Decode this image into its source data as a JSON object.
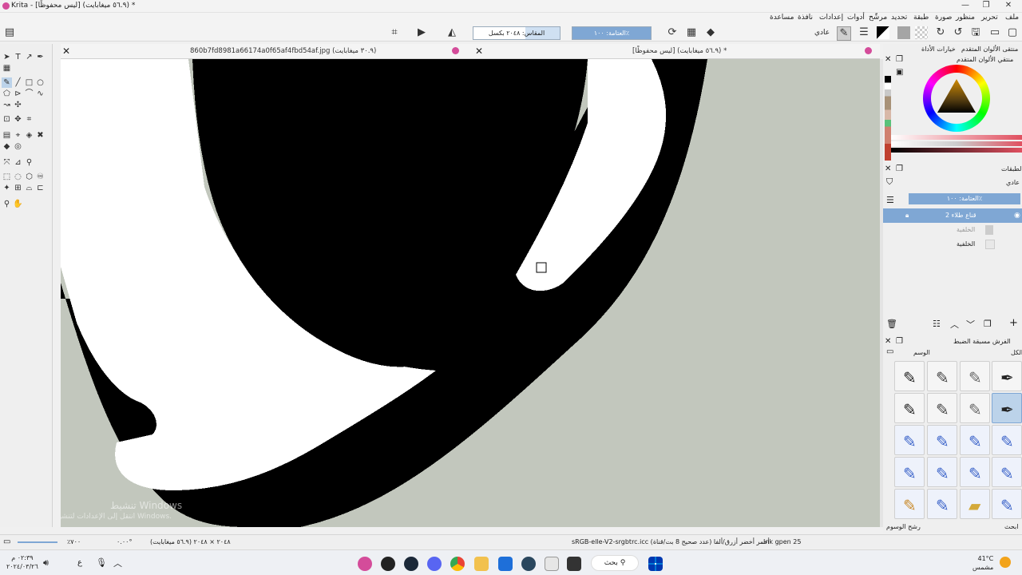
{
  "window": {
    "title": "Krita - [ليس محفوظًا]  (٥٦.٩ ميغابايت) *",
    "controls": [
      "—",
      "❐",
      "✕"
    ]
  },
  "menubar": {
    "items": [
      "ملف",
      "تحرير",
      "منظور",
      "صورة",
      "طبقة",
      "تحديد",
      "مرشّح",
      "أدوات",
      "إعدادات",
      "نافذة",
      "مساعدة"
    ]
  },
  "toolbar": {
    "blend_mode": "عادي",
    "opacity_label": "العتامة: ١٠٠٪",
    "size_label": "المقاس: ٢٠٤٨ بكسل"
  },
  "tabs": [
    {
      "label": "860b7fd8981a66174a0f65af4fbd54af.jpg  (٣٠.٩ ميغابايت)"
    },
    {
      "label": "[ليس محفوظًا]  (٥٦.٩ ميغابايت) *"
    }
  ],
  "right_dock": {
    "top_tabs": [
      "منتقى الألوان المتقدم",
      "خيارات الأداة"
    ],
    "color_panel_title": "منتقي الألوان المتقدم",
    "layers_title": "الطبقات",
    "layers_blend": "عادي",
    "layers_opacity": "العتامة: ١٠٠٪",
    "layers": [
      {
        "name": "قناع طلاء 2",
        "selected": true
      },
      {
        "name": "الخلفية",
        "selected": false
      },
      {
        "name": "الخلفية",
        "selected": false
      }
    ],
    "brushes_title": "الفرش مسبقة الضبط",
    "brushes_filter_label": "الكل",
    "brushes_tag_label": "الوسم",
    "brushes_footer_filter": "رشح الوسوم",
    "brushes_footer_search": "ابحث"
  },
  "status": {
    "brush_name": "Ink gpen 25",
    "color_profile": "sRGB-elle-V2-srgbtrc.icc  (أحمر أخضر أزرق/ألفا (عدد صحيح 8 بت/قناة",
    "dimensions": "٢٠٤٨ × ٢٠٤٨  (٥٦.٩ ميغابايت)",
    "zoom": "٪٧٠٠",
    "rotation": "٠.٠٠°"
  },
  "watermark": {
    "line1": "تنشيط Windows",
    "line2": "انتقل إلى الإعدادات لتنشيط Windows."
  },
  "taskbar": {
    "search_label": "بحث",
    "time": "٠٢:٣٩ م",
    "date": "٢٠٢٤/٠٣/٢٦",
    "weather_temp": "41°C",
    "weather_desc": "مشمس",
    "lang": "ع"
  },
  "colors": {
    "canvas_bg": "#c2c7bd",
    "accent_selection": "#7fa7d4",
    "ink": "#000000"
  }
}
